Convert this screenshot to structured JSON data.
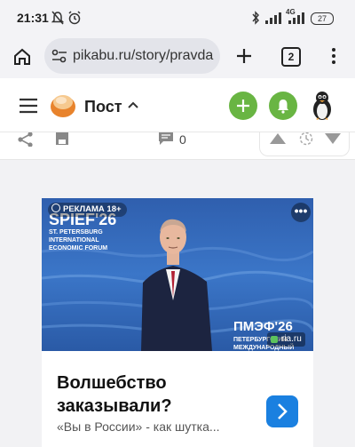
{
  "status": {
    "time": "21:31",
    "battery": "27",
    "network": "4G"
  },
  "browser": {
    "url": "pikabu.ru/story/pravda",
    "tab_count": "2"
  },
  "header": {
    "title": "Пост"
  },
  "post_actions": {
    "comments_count": "0"
  },
  "ad": {
    "label": "РЕКЛАМА 18+",
    "image_text_1": "SPIEF'26",
    "image_text_2": "ST. PETERSBURG INTERNATIONAL ECONOMIC FORUM",
    "image_text_3": "ПМЭФ'26",
    "image_text_4": "ПЕТЕРБУРГСКИЙ МЕЖДУНАРОДНЫЙ",
    "source": "ria.ru",
    "title": "Волшебство заказывали?",
    "subtitle": "«Вы в России» - как шутка..."
  }
}
